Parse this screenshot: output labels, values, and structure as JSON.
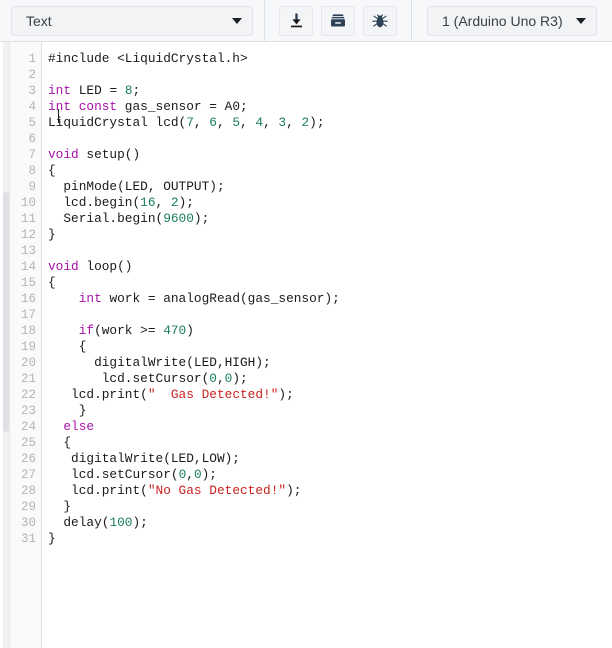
{
  "toolbar": {
    "mode_select": {
      "value": "Text",
      "icon": "chevron-down-icon"
    },
    "buttons": [
      {
        "name": "upload-button",
        "icon": "download-arrow-icon",
        "title": "Upload"
      },
      {
        "name": "library-button",
        "icon": "drawer-box-icon",
        "title": "Library"
      },
      {
        "name": "debug-button",
        "icon": "bug-icon",
        "title": "Debug"
      }
    ],
    "board_select": {
      "value": "1 (Arduino Uno R3)",
      "icon": "chevron-down-icon"
    }
  },
  "editor": {
    "language": "arduino-cpp",
    "first_line": 1,
    "total_lines": 31,
    "cursor_line": 2,
    "cursor_column": 1,
    "colors": {
      "keyword": "#aa11aa",
      "number": "#1a7f5a",
      "string": "#cc2222",
      "plain": "#1a1a1a",
      "gutter_text": "#b4b4b4",
      "gutter_bg": "#fafafa",
      "background": "#ffffff"
    },
    "line_numbers": [
      1,
      2,
      3,
      4,
      5,
      6,
      7,
      8,
      9,
      10,
      11,
      12,
      13,
      14,
      15,
      16,
      17,
      18,
      19,
      20,
      21,
      22,
      23,
      24,
      25,
      26,
      27,
      28,
      29,
      30,
      31
    ],
    "lines": [
      {
        "n": 1,
        "tokens": [
          {
            "t": "pl",
            "v": "#include <LiquidCrystal.h>"
          }
        ]
      },
      {
        "n": 2,
        "tokens": []
      },
      {
        "n": 3,
        "tokens": [
          {
            "t": "kw",
            "v": "int"
          },
          {
            "t": "pl",
            "v": " LED = "
          },
          {
            "t": "num",
            "v": "8"
          },
          {
            "t": "pl",
            "v": ";"
          }
        ]
      },
      {
        "n": 4,
        "tokens": [
          {
            "t": "kw",
            "v": "int const"
          },
          {
            "t": "pl",
            "v": " gas_sensor = A0;"
          }
        ]
      },
      {
        "n": 5,
        "tokens": [
          {
            "t": "pl",
            "v": "LiquidCrystal lcd("
          },
          {
            "t": "num",
            "v": "7"
          },
          {
            "t": "pl",
            "v": ", "
          },
          {
            "t": "num",
            "v": "6"
          },
          {
            "t": "pl",
            "v": ", "
          },
          {
            "t": "num",
            "v": "5"
          },
          {
            "t": "pl",
            "v": ", "
          },
          {
            "t": "num",
            "v": "4"
          },
          {
            "t": "pl",
            "v": ", "
          },
          {
            "t": "num",
            "v": "3"
          },
          {
            "t": "pl",
            "v": ", "
          },
          {
            "t": "num",
            "v": "2"
          },
          {
            "t": "pl",
            "v": ");"
          }
        ]
      },
      {
        "n": 6,
        "tokens": []
      },
      {
        "n": 7,
        "tokens": [
          {
            "t": "kw",
            "v": "void"
          },
          {
            "t": "pl",
            "v": " setup()"
          }
        ]
      },
      {
        "n": 8,
        "tokens": [
          {
            "t": "pl",
            "v": "{"
          }
        ]
      },
      {
        "n": 9,
        "tokens": [
          {
            "t": "pl",
            "v": "  pinMode(LED, OUTPUT);"
          }
        ]
      },
      {
        "n": 10,
        "tokens": [
          {
            "t": "pl",
            "v": "  lcd.begin("
          },
          {
            "t": "num",
            "v": "16"
          },
          {
            "t": "pl",
            "v": ", "
          },
          {
            "t": "num",
            "v": "2"
          },
          {
            "t": "pl",
            "v": ");"
          }
        ]
      },
      {
        "n": 11,
        "tokens": [
          {
            "t": "pl",
            "v": "  Serial.begin("
          },
          {
            "t": "num",
            "v": "9600"
          },
          {
            "t": "pl",
            "v": ");"
          }
        ]
      },
      {
        "n": 12,
        "tokens": [
          {
            "t": "pl",
            "v": "}"
          }
        ]
      },
      {
        "n": 13,
        "tokens": []
      },
      {
        "n": 14,
        "tokens": [
          {
            "t": "kw",
            "v": "void"
          },
          {
            "t": "pl",
            "v": " loop()"
          }
        ]
      },
      {
        "n": 15,
        "tokens": [
          {
            "t": "pl",
            "v": "{"
          }
        ]
      },
      {
        "n": 16,
        "tokens": [
          {
            "t": "pl",
            "v": "    "
          },
          {
            "t": "kw",
            "v": "int"
          },
          {
            "t": "pl",
            "v": " work = analogRead(gas_sensor);"
          }
        ]
      },
      {
        "n": 17,
        "tokens": []
      },
      {
        "n": 18,
        "tokens": [
          {
            "t": "pl",
            "v": "    "
          },
          {
            "t": "kw",
            "v": "if"
          },
          {
            "t": "pl",
            "v": "(work >= "
          },
          {
            "t": "num",
            "v": "470"
          },
          {
            "t": "pl",
            "v": ")"
          }
        ]
      },
      {
        "n": 19,
        "tokens": [
          {
            "t": "pl",
            "v": "    {"
          }
        ]
      },
      {
        "n": 20,
        "tokens": [
          {
            "t": "pl",
            "v": "      digitalWrite(LED,HIGH);"
          }
        ]
      },
      {
        "n": 21,
        "tokens": [
          {
            "t": "pl",
            "v": "       lcd.setCursor("
          },
          {
            "t": "num",
            "v": "0"
          },
          {
            "t": "pl",
            "v": ","
          },
          {
            "t": "num",
            "v": "0"
          },
          {
            "t": "pl",
            "v": ");"
          }
        ]
      },
      {
        "n": 22,
        "tokens": [
          {
            "t": "pl",
            "v": "   lcd.print("
          },
          {
            "t": "str",
            "v": "\"  Gas Detected!\""
          },
          {
            "t": "pl",
            "v": ");"
          }
        ]
      },
      {
        "n": 23,
        "tokens": [
          {
            "t": "pl",
            "v": "    }"
          }
        ]
      },
      {
        "n": 24,
        "tokens": [
          {
            "t": "pl",
            "v": "  "
          },
          {
            "t": "kw",
            "v": "else"
          }
        ]
      },
      {
        "n": 25,
        "tokens": [
          {
            "t": "pl",
            "v": "  {"
          }
        ]
      },
      {
        "n": 26,
        "tokens": [
          {
            "t": "pl",
            "v": "   digitalWrite(LED,LOW);"
          }
        ]
      },
      {
        "n": 27,
        "tokens": [
          {
            "t": "pl",
            "v": "   lcd.setCursor("
          },
          {
            "t": "num",
            "v": "0"
          },
          {
            "t": "pl",
            "v": ","
          },
          {
            "t": "num",
            "v": "0"
          },
          {
            "t": "pl",
            "v": ");"
          }
        ]
      },
      {
        "n": 28,
        "tokens": [
          {
            "t": "pl",
            "v": "   lcd.print("
          },
          {
            "t": "str",
            "v": "\"No Gas Detected!\""
          },
          {
            "t": "pl",
            "v": ");"
          }
        ]
      },
      {
        "n": 29,
        "tokens": [
          {
            "t": "pl",
            "v": "  }"
          }
        ]
      },
      {
        "n": 30,
        "tokens": [
          {
            "t": "pl",
            "v": "  delay("
          },
          {
            "t": "num",
            "v": "100"
          },
          {
            "t": "pl",
            "v": ");"
          }
        ]
      },
      {
        "n": 31,
        "tokens": [
          {
            "t": "pl",
            "v": "}"
          }
        ]
      }
    ]
  }
}
